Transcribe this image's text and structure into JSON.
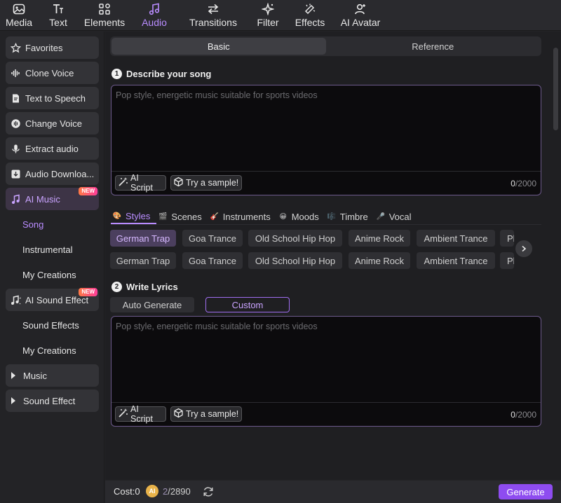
{
  "toolbar": {
    "items": [
      {
        "label": "Media",
        "icon": "media-icon"
      },
      {
        "label": "Text",
        "icon": "text-icon"
      },
      {
        "label": "Elements",
        "icon": "elements-icon"
      },
      {
        "label": "Audio",
        "icon": "audio-icon"
      },
      {
        "label": "Transitions",
        "icon": "transitions-icon"
      },
      {
        "label": "Filter",
        "icon": "filter-icon"
      },
      {
        "label": "Effects",
        "icon": "effects-icon"
      },
      {
        "label": "AI Avatar",
        "icon": "ai-avatar-icon"
      }
    ],
    "active": "Audio",
    "accent": "#b98cff"
  },
  "sidebar": {
    "items": [
      {
        "label": "Favorites",
        "icon": "star-icon"
      },
      {
        "label": "Clone Voice",
        "icon": "waveform-icon"
      },
      {
        "label": "Text to Speech",
        "icon": "document-speech-icon"
      },
      {
        "label": "Change Voice",
        "icon": "voice-change-icon"
      },
      {
        "label": "Extract audio",
        "icon": "microphone-icon"
      },
      {
        "label": "Audio Downloa...",
        "icon": "download-icon"
      },
      {
        "label": "AI Music",
        "icon": "music-note-icon",
        "badge": "NEW"
      },
      {
        "label": "Song"
      },
      {
        "label": "Instrumental"
      },
      {
        "label": "My Creations"
      },
      {
        "label": "AI Sound Effect",
        "icon": "sound-effect-icon",
        "badge": "NEW"
      },
      {
        "label": "Sound Effects"
      },
      {
        "label": "My Creations"
      },
      {
        "label": "Music",
        "icon": "caret-right-icon"
      },
      {
        "label": "Sound Effect",
        "icon": "caret-right-icon"
      }
    ]
  },
  "main": {
    "tabs": [
      {
        "label": "Basic"
      },
      {
        "label": "Reference"
      }
    ],
    "describe": {
      "step": "1",
      "title": "Describe your song",
      "placeholder": "Pop style, energetic music suitable for sports videos",
      "ai_script": "AI Script",
      "sample": "Try a sample!",
      "count": "0",
      "max": "/2000"
    },
    "style_tabs": [
      {
        "label": "Styles",
        "icon": "styles-icon"
      },
      {
        "label": "Scenes",
        "icon": "scenes-icon"
      },
      {
        "label": "Instruments",
        "icon": "guitar-icon"
      },
      {
        "label": "Moods",
        "icon": "mood-icon"
      },
      {
        "label": "Timbre",
        "icon": "timbre-icon"
      },
      {
        "label": "Vocal",
        "icon": "vocal-icon"
      }
    ],
    "chips_row1": [
      "German Trap",
      "Goa Trance",
      "Old School Hip Hop",
      "Anime Rock",
      "Ambient Trance",
      "Pl"
    ],
    "chips_row2": [
      "German Trap",
      "Goa Trance",
      "Old School Hip Hop",
      "Anime Rock",
      "Ambient Trance",
      "Pl"
    ],
    "lyrics": {
      "step": "2",
      "title": "Write Lyrics",
      "modes": [
        "Auto Generate",
        "Custom"
      ],
      "placeholder": "Pop style, energetic music suitable for sports videos",
      "ai_script": "AI Script",
      "sample": "Try a sample!",
      "count": "0",
      "max": "/2000"
    }
  },
  "bottom": {
    "cost_label": "Cost:0",
    "coin_label": "AI",
    "credits_used": "2",
    "credits_total": "/2890",
    "generate": "Generate",
    "generate_color": "#8e4cf0"
  }
}
